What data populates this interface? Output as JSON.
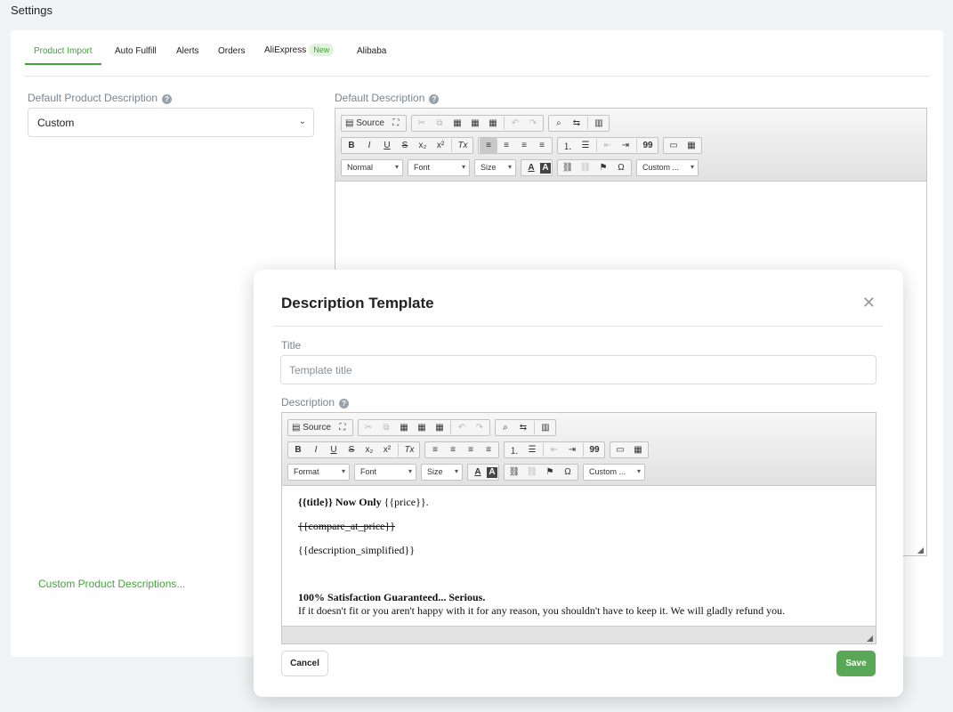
{
  "page": {
    "title": "Settings"
  },
  "tabs": [
    {
      "label": "Product Import"
    },
    {
      "label": "Auto Fulfill"
    },
    {
      "label": "Alerts"
    },
    {
      "label": "Orders"
    },
    {
      "label": "AliExpress",
      "badge": "New"
    },
    {
      "label": "Alibaba"
    }
  ],
  "left": {
    "label": "Default Product Description",
    "select_value": "Custom",
    "link": "Custom Product Descriptions..."
  },
  "right": {
    "label": "Default Description"
  },
  "toolbar": {
    "source": "Source",
    "styles": "Normal",
    "format": "Format",
    "font": "Font",
    "size": "Size",
    "custom": "Custom ...",
    "bold": "B",
    "italic": "I",
    "underline": "U",
    "strike": "S",
    "sub": "x₂",
    "sup": "x²",
    "clear": "Tx",
    "blockquote": "99",
    "omega": "Ω",
    "textcolor": "A",
    "bgcolor": "A"
  },
  "modal": {
    "title": "Description Template",
    "title_label": "Title",
    "title_placeholder": "Template title",
    "desc_label": "Description",
    "content": {
      "line1_bold": "{{title}} Now Only",
      "line1_rest": " {{price}}.",
      "line2": "{{compare_at_price}}",
      "line3": "{{description_simplified}}",
      "line4": "100% Satisfaction Guaranteed... Serious.",
      "line5": "If it doesn't fit or you aren't happy with it for any reason, you shouldn't have to keep it. We will gladly refund you."
    },
    "cancel": "Cancel",
    "save": "Save"
  },
  "colors": {
    "accent": "#45a33b",
    "save_button": "#5aa857"
  }
}
